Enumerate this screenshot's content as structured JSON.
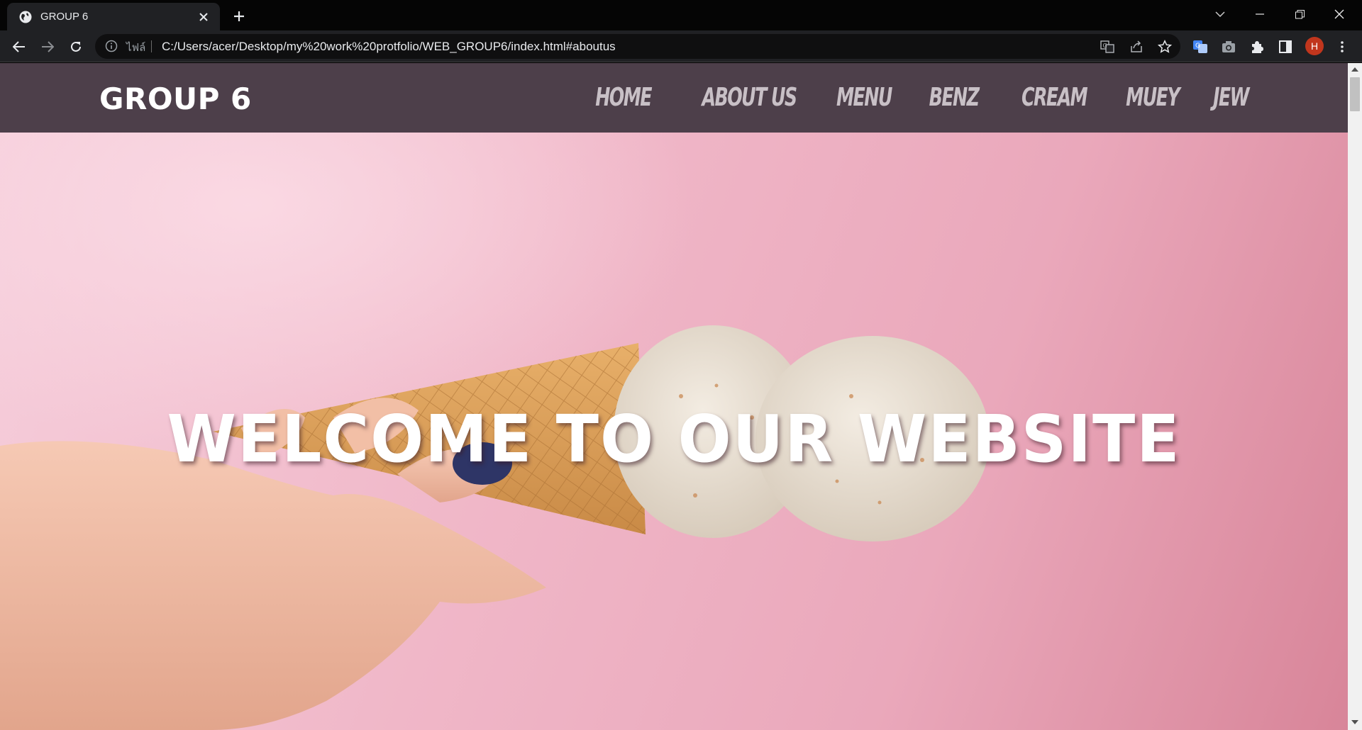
{
  "browser": {
    "tab_title": "GROUP 6",
    "address_chip": "ไฟล์",
    "url": "C:/Users/acer/Desktop/my%20work%20protfolio/WEB_GROUP6/index.html#aboutus",
    "profile_initial": "H"
  },
  "site": {
    "logo": "GROUP 6",
    "nav": [
      "HOME",
      "ABOUT US",
      "MENU",
      "BENZ",
      "CREAM",
      "MUEY",
      "JEW"
    ],
    "hero_heading": "WELCOME TO OUR WEBSITE"
  },
  "icons": {
    "tab_favicon": "globe-icon",
    "tab_close": "close-icon",
    "new_tab": "plus-icon",
    "back": "arrow-left-icon",
    "forward": "arrow-right-icon",
    "reload": "reload-icon",
    "site_info": "info-icon",
    "translate": "translate-icon",
    "share": "share-icon",
    "bookmark": "star-icon",
    "extension_1": "translate-extension-icon",
    "extension_2": "camera-icon",
    "extensions": "puzzle-icon",
    "side_panel": "side-panel-icon",
    "menu": "more-vert-icon"
  },
  "colors": {
    "header_bg": "#4d3f4a",
    "nav_text": "#c8c0c6",
    "hero_pink": "#f0b7c8",
    "avatar": "#c1361d"
  }
}
